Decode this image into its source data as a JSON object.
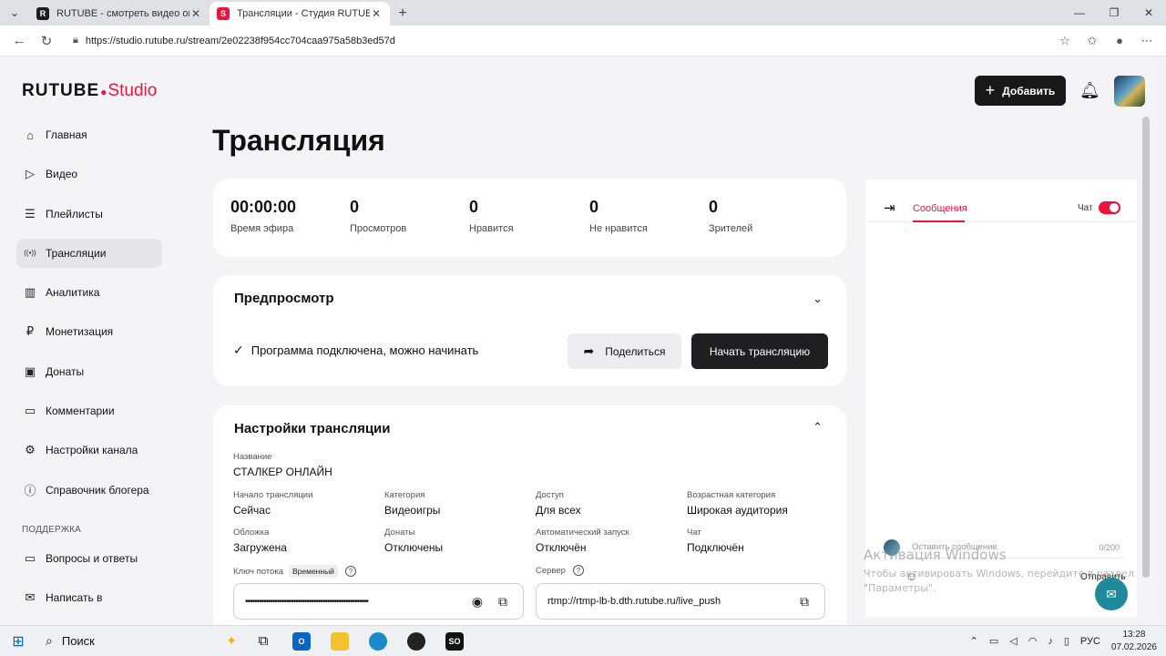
{
  "browser": {
    "tabs": [
      {
        "title": "RUTUBE - смотреть видео онлай",
        "favicon": "R",
        "color": "#1d1d1f",
        "active": false
      },
      {
        "title": "Трансляции - Студия RUTUBE",
        "favicon": "S",
        "color": "#ed143b",
        "active": true
      }
    ],
    "url": "https://studio.rutube.ru/stream/2e02238f954cc704caa975a58b3ed57d"
  },
  "header": {
    "logo_main": "RUTUBE",
    "logo_studio": "Studio",
    "add_label": "Добавить"
  },
  "sidebar": {
    "items": [
      {
        "label": "Главная",
        "icon": "home-icon",
        "glyph": "⌂"
      },
      {
        "label": "Видео",
        "icon": "video-icon",
        "glyph": "▷"
      },
      {
        "label": "Плейлисты",
        "icon": "playlist-icon",
        "glyph": "☰"
      },
      {
        "label": "Трансляции",
        "icon": "broadcast-icon",
        "glyph": "((•))"
      },
      {
        "label": "Аналитика",
        "icon": "analytics-icon",
        "glyph": "▥"
      },
      {
        "label": "Монетизация",
        "icon": "ruble-icon",
        "glyph": "₽"
      },
      {
        "label": "Донаты",
        "icon": "wallet-icon",
        "glyph": "▣"
      },
      {
        "label": "Комментарии",
        "icon": "comment-icon",
        "glyph": "▭"
      },
      {
        "label": "Настройки канала",
        "icon": "gear-icon",
        "glyph": "⚙"
      },
      {
        "label": "Справочник блогера",
        "icon": "info-icon",
        "glyph": "ⓘ"
      }
    ],
    "section_label": "ПОДДЕРЖКА",
    "support_items": [
      {
        "label": "Вопросы и ответы",
        "icon": "faq-icon",
        "glyph": "▭"
      },
      {
        "label": "Написать в",
        "icon": "mail-icon",
        "glyph": "✉"
      }
    ]
  },
  "page_title": "Трансляция",
  "stats": [
    {
      "value": "00:00:00",
      "label": "Время эфира"
    },
    {
      "value": "0",
      "label": "Просмотров"
    },
    {
      "value": "0",
      "label": "Нравится"
    },
    {
      "value": "0",
      "label": "Не нравится"
    },
    {
      "value": "0",
      "label": "Зрителей"
    }
  ],
  "preview": {
    "title": "Предпросмотр",
    "status": "Программа подключена, можно начинать",
    "share_label": "Поделиться",
    "start_label": "Начать трансляцию"
  },
  "settings": {
    "title": "Настройки трансляции",
    "name_label": "Название",
    "name_value": "СТАЛКЕР ОНЛАЙН",
    "fields": [
      {
        "label": "Начало трансляции",
        "value": "Сейчас"
      },
      {
        "label": "Категория",
        "value": "Видеоигры"
      },
      {
        "label": "Доступ",
        "value": "Для всех"
      },
      {
        "label": "Возрастная категория",
        "value": "Широкая аудитория"
      },
      {
        "label": "Обложка",
        "value": "Загружена"
      },
      {
        "label": "Донаты",
        "value": "Отключены"
      },
      {
        "label": "Автоматический запуск",
        "value": "Отключён"
      },
      {
        "label": "Чат",
        "value": "Подключён"
      }
    ],
    "key_label": "Ключ потока",
    "key_badge": "Временный",
    "key_value": "••••••••••••••••••••••••••••••••••••••••••••••••••••••",
    "server_label": "Сервер",
    "server_value": "rtmp://rtmp-lb-b.dth.rutube.ru/live_push"
  },
  "chat": {
    "tab_label": "Сообщения",
    "chat_label": "Чат",
    "input_placeholder": "Оставить сообщение",
    "counter": "0/200",
    "send_label": "Отправить"
  },
  "watermark": {
    "line1": "Активация Windows",
    "line2": "Чтобы активировать Windows, перейдите в раздел \"Параметры\"."
  },
  "taskbar": {
    "search_label": "Поиск",
    "lang": "РУС",
    "time": "13:28",
    "date": "07.02.2026"
  },
  "colors": {
    "accent": "#ed143b",
    "dark_button": "#1f1f22"
  }
}
